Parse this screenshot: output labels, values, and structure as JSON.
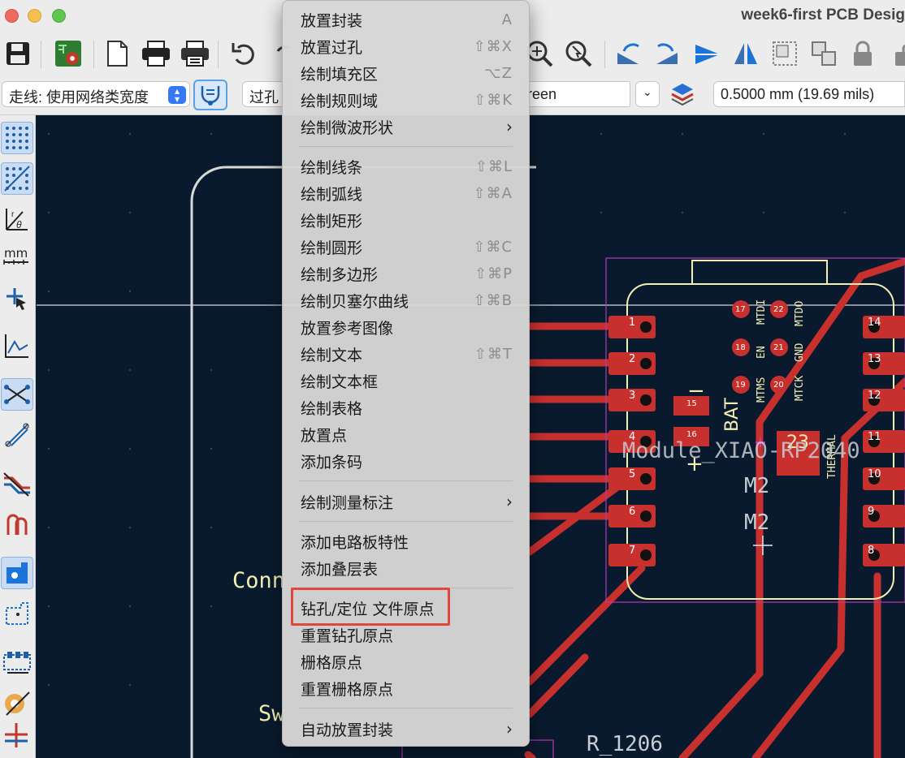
{
  "window": {
    "title": "week6-first PCB Desig"
  },
  "options": {
    "track_select": "走线: 使用网络类宽度",
    "via_select": "过孔",
    "layer_select": "reen",
    "grid_value": "0.5000 mm (19.69 mils)"
  },
  "canvas": {
    "labels": {
      "conn": "Conn",
      "sw": "Sw",
      "r1206": "R_1206",
      "module": "Module_XIAO-RP2040",
      "m2_a": "M2",
      "m2_b": "M2",
      "bat": "BAT",
      "thermal": "THERMAL",
      "pad23": "23",
      "minus": "−",
      "plus": "+"
    },
    "top_pins": [
      {
        "num": "17",
        "name": "MTDI"
      },
      {
        "num": "22",
        "name": "MTDO"
      },
      {
        "num": "18",
        "name": "EN"
      },
      {
        "num": "21",
        "name": "GND"
      },
      {
        "num": "19",
        "name": "MTMS"
      },
      {
        "num": "20",
        "name": "MTCK"
      }
    ],
    "left_pads": [
      "1",
      "2",
      "3",
      "4",
      "5",
      "6",
      "7"
    ],
    "right_pads": [
      "14",
      "13",
      "12",
      "11",
      "10",
      "9",
      "8"
    ],
    "bat_pads": [
      "15",
      "16"
    ]
  },
  "menu": {
    "items": [
      {
        "label": "放置封装",
        "shortcut": "A"
      },
      {
        "label": "放置过孔",
        "shortcut": "⇧⌘X"
      },
      {
        "label": "绘制填充区",
        "shortcut": "⌥Z"
      },
      {
        "label": "绘制规则域",
        "shortcut": "⇧⌘K"
      },
      {
        "label": "绘制微波形状",
        "shortcut": "›"
      },
      {
        "label": "绘制线条",
        "shortcut": "⇧⌘L"
      },
      {
        "label": "绘制弧线",
        "shortcut": "⇧⌘A"
      },
      {
        "label": "绘制矩形",
        "shortcut": ""
      },
      {
        "label": "绘制圆形",
        "shortcut": "⇧⌘C"
      },
      {
        "label": "绘制多边形",
        "shortcut": "⇧⌘P"
      },
      {
        "label": "绘制贝塞尔曲线",
        "shortcut": "⇧⌘B"
      },
      {
        "label": "放置参考图像",
        "shortcut": ""
      },
      {
        "label": "绘制文本",
        "shortcut": "⇧⌘T"
      },
      {
        "label": "绘制文本框",
        "shortcut": ""
      },
      {
        "label": "绘制表格",
        "shortcut": ""
      },
      {
        "label": "放置点",
        "shortcut": ""
      },
      {
        "label": "添加条码",
        "shortcut": ""
      },
      {
        "label": "绘制测量标注",
        "shortcut": "›"
      },
      {
        "label": "添加电路板特性",
        "shortcut": ""
      },
      {
        "label": "添加叠层表",
        "shortcut": ""
      },
      {
        "label": "钻孔/定位 文件原点",
        "shortcut": ""
      },
      {
        "label": "重置钻孔原点",
        "shortcut": ""
      },
      {
        "label": "栅格原点",
        "shortcut": ""
      },
      {
        "label": "重置栅格原点",
        "shortcut": ""
      },
      {
        "label": "自动放置封装",
        "shortcut": "›"
      }
    ]
  },
  "colors": {
    "board_bg": "#0a1a2e",
    "copper": "#c8302e",
    "silk": "#f2efb0",
    "highlight": "#e0463a"
  }
}
